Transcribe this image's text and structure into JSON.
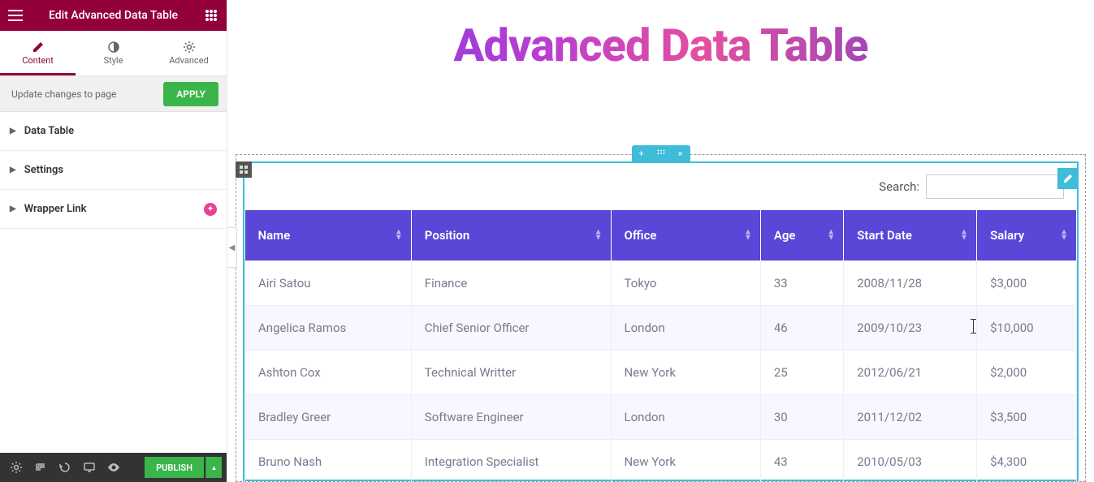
{
  "header": {
    "title": "Edit Advanced Data Table"
  },
  "tabs": {
    "content": "Content",
    "style": "Style",
    "advanced": "Advanced"
  },
  "apply": {
    "text": "Update changes to page",
    "btn": "APPLY"
  },
  "sections": {
    "data_table": "Data Table",
    "settings": "Settings",
    "wrapper_link": "Wrapper Link"
  },
  "footer": {
    "publish": "PUBLISH"
  },
  "page": {
    "title": "Advanced Data Table"
  },
  "search": {
    "label": "Search:"
  },
  "table": {
    "headers": {
      "name": "Name",
      "position": "Position",
      "office": "Office",
      "age": "Age",
      "start_date": "Start Date",
      "salary": "Salary"
    },
    "rows": [
      {
        "name": "Airi Satou",
        "position": "Finance",
        "office": "Tokyo",
        "age": "33",
        "start_date": "2008/11/28",
        "salary": "$3,000"
      },
      {
        "name": "Angelica Ramos",
        "position": "Chief Senior Officer",
        "office": "London",
        "age": "46",
        "start_date": "2009/10/23",
        "salary": "$10,000"
      },
      {
        "name": "Ashton Cox",
        "position": "Technical Writter",
        "office": "New York",
        "age": "25",
        "start_date": "2012/06/21",
        "salary": "$2,000"
      },
      {
        "name": "Bradley Greer",
        "position": "Software Engineer",
        "office": "London",
        "age": "30",
        "start_date": "2011/12/02",
        "salary": "$3,500"
      },
      {
        "name": "Bruno Nash",
        "position": "Integration Specialist",
        "office": "New York",
        "age": "43",
        "start_date": "2010/05/03",
        "salary": "$4,300"
      }
    ]
  }
}
